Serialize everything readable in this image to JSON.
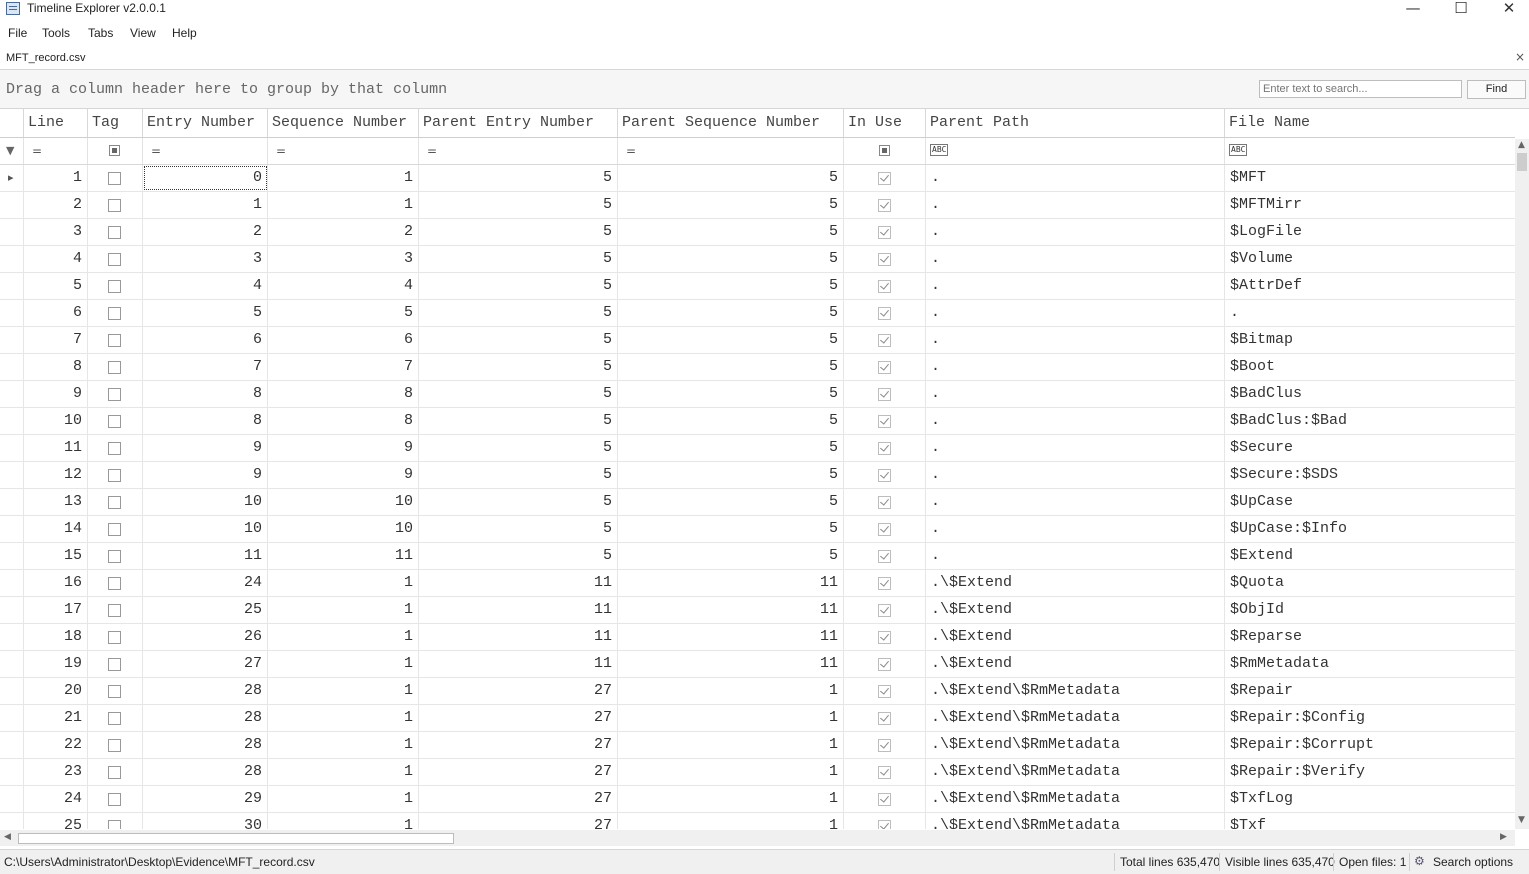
{
  "window": {
    "title": "Timeline Explorer v2.0.0.1",
    "minimize_glyph": "—",
    "maximize_glyph": "☐",
    "close_glyph": "✕"
  },
  "menu": [
    "File",
    "Tools",
    "Tabs",
    "View",
    "Help"
  ],
  "tab": {
    "label": "MFT_record.csv",
    "close_glyph": "×"
  },
  "group_panel": {
    "hint": "Drag a column header here to group by that column"
  },
  "search": {
    "placeholder": "Enter text to search...",
    "find_label": "Find"
  },
  "columns": [
    "Line",
    "Tag",
    "Entry Number",
    "Sequence Number",
    "Parent Entry Number",
    "Parent Sequence Number",
    "In Use",
    "Parent Path",
    "File Name"
  ],
  "filter_ops": {
    "equals": "=",
    "text": "ABC"
  },
  "rows": [
    {
      "line": "1",
      "entry": "0",
      "seq": "1",
      "pentry": "5",
      "pseq": "5",
      "path": ".",
      "name": "$MFT"
    },
    {
      "line": "2",
      "entry": "1",
      "seq": "1",
      "pentry": "5",
      "pseq": "5",
      "path": ".",
      "name": "$MFTMirr"
    },
    {
      "line": "3",
      "entry": "2",
      "seq": "2",
      "pentry": "5",
      "pseq": "5",
      "path": ".",
      "name": "$LogFile"
    },
    {
      "line": "4",
      "entry": "3",
      "seq": "3",
      "pentry": "5",
      "pseq": "5",
      "path": ".",
      "name": "$Volume"
    },
    {
      "line": "5",
      "entry": "4",
      "seq": "4",
      "pentry": "5",
      "pseq": "5",
      "path": ".",
      "name": "$AttrDef"
    },
    {
      "line": "6",
      "entry": "5",
      "seq": "5",
      "pentry": "5",
      "pseq": "5",
      "path": ".",
      "name": "."
    },
    {
      "line": "7",
      "entry": "6",
      "seq": "6",
      "pentry": "5",
      "pseq": "5",
      "path": ".",
      "name": "$Bitmap"
    },
    {
      "line": "8",
      "entry": "7",
      "seq": "7",
      "pentry": "5",
      "pseq": "5",
      "path": ".",
      "name": "$Boot"
    },
    {
      "line": "9",
      "entry": "8",
      "seq": "8",
      "pentry": "5",
      "pseq": "5",
      "path": ".",
      "name": "$BadClus"
    },
    {
      "line": "10",
      "entry": "8",
      "seq": "8",
      "pentry": "5",
      "pseq": "5",
      "path": ".",
      "name": "$BadClus:$Bad"
    },
    {
      "line": "11",
      "entry": "9",
      "seq": "9",
      "pentry": "5",
      "pseq": "5",
      "path": ".",
      "name": "$Secure"
    },
    {
      "line": "12",
      "entry": "9",
      "seq": "9",
      "pentry": "5",
      "pseq": "5",
      "path": ".",
      "name": "$Secure:$SDS"
    },
    {
      "line": "13",
      "entry": "10",
      "seq": "10",
      "pentry": "5",
      "pseq": "5",
      "path": ".",
      "name": "$UpCase"
    },
    {
      "line": "14",
      "entry": "10",
      "seq": "10",
      "pentry": "5",
      "pseq": "5",
      "path": ".",
      "name": "$UpCase:$Info"
    },
    {
      "line": "15",
      "entry": "11",
      "seq": "11",
      "pentry": "5",
      "pseq": "5",
      "path": ".",
      "name": "$Extend"
    },
    {
      "line": "16",
      "entry": "24",
      "seq": "1",
      "pentry": "11",
      "pseq": "11",
      "path": ".\\$Extend",
      "name": "$Quota"
    },
    {
      "line": "17",
      "entry": "25",
      "seq": "1",
      "pentry": "11",
      "pseq": "11",
      "path": ".\\$Extend",
      "name": "$ObjId"
    },
    {
      "line": "18",
      "entry": "26",
      "seq": "1",
      "pentry": "11",
      "pseq": "11",
      "path": ".\\$Extend",
      "name": "$Reparse"
    },
    {
      "line": "19",
      "entry": "27",
      "seq": "1",
      "pentry": "11",
      "pseq": "11",
      "path": ".\\$Extend",
      "name": "$RmMetadata"
    },
    {
      "line": "20",
      "entry": "28",
      "seq": "1",
      "pentry": "27",
      "pseq": "1",
      "path": ".\\$Extend\\$RmMetadata",
      "name": "$Repair"
    },
    {
      "line": "21",
      "entry": "28",
      "seq": "1",
      "pentry": "27",
      "pseq": "1",
      "path": ".\\$Extend\\$RmMetadata",
      "name": "$Repair:$Config"
    },
    {
      "line": "22",
      "entry": "28",
      "seq": "1",
      "pentry": "27",
      "pseq": "1",
      "path": ".\\$Extend\\$RmMetadata",
      "name": "$Repair:$Corrupt"
    },
    {
      "line": "23",
      "entry": "28",
      "seq": "1",
      "pentry": "27",
      "pseq": "1",
      "path": ".\\$Extend\\$RmMetadata",
      "name": "$Repair:$Verify"
    },
    {
      "line": "24",
      "entry": "29",
      "seq": "1",
      "pentry": "27",
      "pseq": "1",
      "path": ".\\$Extend\\$RmMetadata",
      "name": "$TxfLog"
    },
    {
      "line": "25",
      "entry": "30",
      "seq": "1",
      "pentry": "27",
      "pseq": "1",
      "path": ".\\$Extend\\$RmMetadata",
      "name": "$Txf"
    }
  ],
  "status": {
    "path": "C:\\Users\\Administrator\\Desktop\\Evidence\\MFT_record.csv",
    "total_lines": "Total lines 635,470",
    "visible_lines": "Visible lines 635,470",
    "open_files": "Open files: 1",
    "search_options": "Search options"
  }
}
